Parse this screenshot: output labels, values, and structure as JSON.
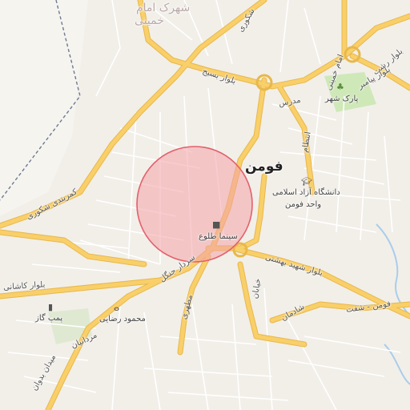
{
  "map": {
    "city_label": "فومن",
    "faded_labels": [
      "شهرک امام",
      "خمینی"
    ],
    "roads": {
      "road_1": "بلوار رشت",
      "road_2": "امام خمینی",
      "road_3": "بلوار بسیج",
      "road_4": "مدرس",
      "road_5": "انتظام",
      "road_6": "کمربندی شکوری",
      "road_7": "بلوار کاشانی",
      "road_8": "سردار جنگل",
      "road_9": "بلوار شهید بهشتی",
      "road_10": "فومن - شفت",
      "road_11": "شادمان",
      "road_12": "میدان بدوان",
      "road_13": "مردانیان",
      "road_14": "مطهری",
      "road_15": "خیابان",
      "road_16": "بلوار پیامبر",
      "road_17": "شکوری"
    },
    "pois": {
      "park": "پارک شهر",
      "university_line1": "دانشگاه آزاد اسلامی",
      "university_line2": "واحد فومن",
      "cinema": "سینما طلوع",
      "restaurant": "محمود رضایی",
      "gas_station": "پمپ گاز"
    },
    "icons": {
      "park": "tree-icon",
      "university": "graduation-cap-icon",
      "cinema": "camera-icon",
      "restaurant": "fork-knife-icon",
      "gas_station": "fuel-icon"
    },
    "colors": {
      "background": "#f2efe9",
      "road_major": "#f9cf6a",
      "road_major_casing": "#e8b84a",
      "road_minor": "#ffffff",
      "highlight_circle_fill": "#f4a3a8",
      "highlight_circle_stroke": "#e35f6b",
      "park_green": "#cfe8b8",
      "water": "#aacdea",
      "boundary": "#6b7a93"
    }
  }
}
